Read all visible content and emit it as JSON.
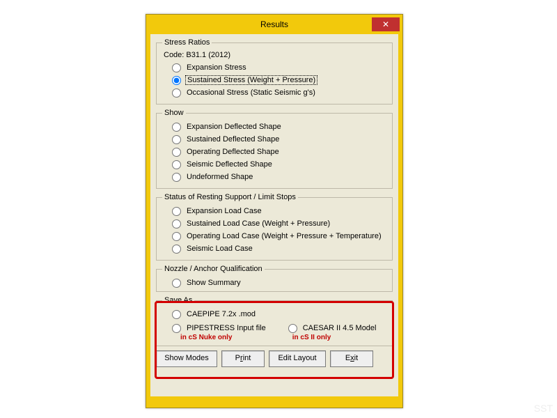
{
  "window": {
    "title": "Results"
  },
  "stressRatios": {
    "legend": "Stress Ratios",
    "code": "Code: B31.1 (2012)",
    "options": [
      {
        "label": "Expansion Stress",
        "checked": false
      },
      {
        "label": "Sustained Stress (Weight + Pressure)",
        "checked": true
      },
      {
        "label": "Occasional Stress (Static Seismic g's)",
        "checked": false
      }
    ]
  },
  "show": {
    "legend": "Show",
    "options": [
      {
        "label": "Expansion Deflected Shape"
      },
      {
        "label": "Sustained Deflected Shape"
      },
      {
        "label": "Operating Deflected Shape"
      },
      {
        "label": "Seismic Deflected Shape"
      },
      {
        "label": "Undeformed Shape"
      }
    ]
  },
  "status": {
    "legend": "Status of Resting Support / Limit Stops",
    "options": [
      {
        "label": "Expansion Load Case"
      },
      {
        "label": "Sustained Load Case (Weight + Pressure)"
      },
      {
        "label": "Operating Load Case (Weight + Pressure + Temperature)"
      },
      {
        "label": "Seismic Load Case"
      }
    ]
  },
  "nozzle": {
    "legend": "Nozzle / Anchor Qualification",
    "options": [
      {
        "label": "Show Summary"
      }
    ]
  },
  "saveAs": {
    "legend": "Save As",
    "options": [
      {
        "label": "CAEPIPE 7.2x .mod"
      },
      {
        "label": "PIPESTRESS Input file"
      },
      {
        "label": "CAESAR II 4.5 Model"
      }
    ],
    "annot1": "in cS Nuke only",
    "annot2": "in cS II only"
  },
  "buttons": {
    "showModes": "Show Modes",
    "print_pre": "P",
    "print_u": "r",
    "print_post": "int",
    "editLayout": "Edit Layout",
    "exit_pre": "E",
    "exit_u": "x",
    "exit_post": "it"
  },
  "watermark": "SST"
}
